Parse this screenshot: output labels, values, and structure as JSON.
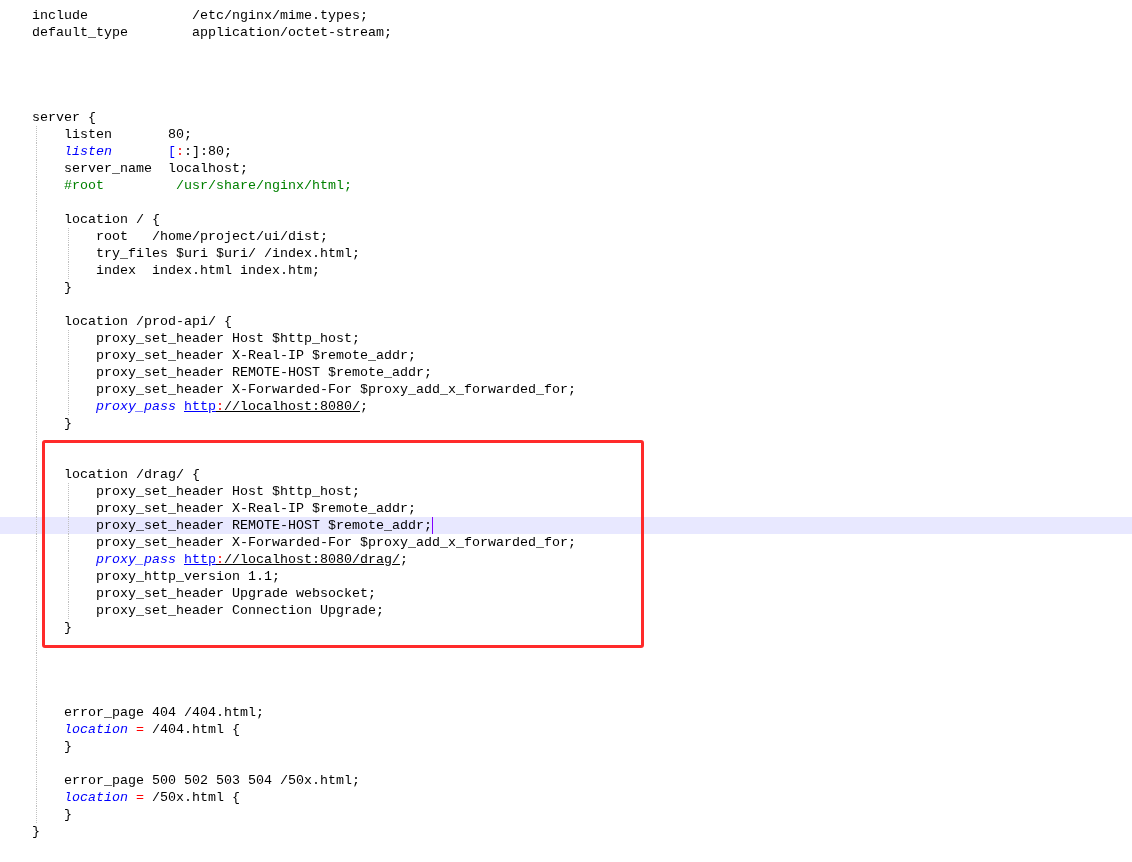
{
  "editor": {
    "lines": [
      {
        "kind": "code",
        "text": "include             /etc/nginx/mime.types;",
        "current": false
      },
      {
        "kind": "code",
        "text": "default_type        application/octet-stream;",
        "current": false
      },
      {
        "kind": "blank"
      },
      {
        "kind": "blank"
      },
      {
        "kind": "blank"
      },
      {
        "kind": "blank"
      },
      {
        "kind": "code",
        "text": "server {",
        "current": false
      },
      {
        "kind": "code",
        "text": "    listen       80;",
        "current": false
      },
      {
        "kind": "rich",
        "tokens": [
          {
            "kind": "kw",
            "text": "    listen       "
          },
          {
            "kind": "br",
            "text": "["
          },
          {
            "kind": "op",
            "text": ":"
          },
          {
            "kind": "plain",
            "text": ":]:80;"
          }
        ],
        "current": false
      },
      {
        "kind": "code",
        "text": "    server_name  localhost;",
        "current": false
      },
      {
        "kind": "rich",
        "tokens": [
          {
            "kind": "cm",
            "text": "    #root         /usr/share/nginx/html;"
          }
        ],
        "current": false
      },
      {
        "kind": "blank"
      },
      {
        "kind": "code",
        "text": "    location / {",
        "current": false
      },
      {
        "kind": "code",
        "text": "        root   /home/project/ui/dist;",
        "current": false
      },
      {
        "kind": "code",
        "text": "        try_files $uri $uri/ /index.html;",
        "current": false
      },
      {
        "kind": "code",
        "text": "        index  index.html index.htm;",
        "current": false
      },
      {
        "kind": "code",
        "text": "    }",
        "current": false
      },
      {
        "kind": "blank"
      },
      {
        "kind": "code",
        "text": "    location /prod-api/ {",
        "current": false
      },
      {
        "kind": "code",
        "text": "        proxy_set_header Host $http_host;",
        "current": false
      },
      {
        "kind": "code",
        "text": "        proxy_set_header X-Real-IP $remote_addr;",
        "current": false
      },
      {
        "kind": "code",
        "text": "        proxy_set_header REMOTE-HOST $remote_addr;",
        "current": false
      },
      {
        "kind": "code",
        "text": "        proxy_set_header X-Forwarded-For $proxy_add_x_forwarded_for;",
        "current": false
      },
      {
        "kind": "rich",
        "tokens": [
          {
            "kind": "kw",
            "text": "        proxy_pass "
          },
          {
            "kind": "scheme",
            "text": "http"
          },
          {
            "kind": "sep",
            "text": ":"
          },
          {
            "kind": "path",
            "text": "//localhost:8080/"
          },
          {
            "kind": "plain",
            "text": ";"
          }
        ],
        "current": false
      },
      {
        "kind": "code",
        "text": "    }",
        "current": false
      },
      {
        "kind": "blank"
      },
      {
        "kind": "annotation_box",
        "color": "#ff2a2a",
        "lines": [
          {
            "kind": "blank"
          },
          {
            "kind": "code",
            "text": "    location /drag/ {",
            "current": false
          },
          {
            "kind": "code",
            "text": "        proxy_set_header Host $http_host;",
            "current": false
          },
          {
            "kind": "code",
            "text": "        proxy_set_header X-Real-IP $remote_addr;",
            "current": false
          },
          {
            "kind": "code",
            "text": "        proxy_set_header REMOTE-HOST $remote_addr;",
            "current": true
          },
          {
            "kind": "code",
            "text": "        proxy_set_header X-Forwarded-For $proxy_add_x_forwarded_for;",
            "current": false
          },
          {
            "kind": "rich",
            "tokens": [
              {
                "kind": "kw",
                "text": "        proxy_pass "
              },
              {
                "kind": "scheme",
                "text": "http"
              },
              {
                "kind": "sep",
                "text": ":"
              },
              {
                "kind": "path",
                "text": "//localhost:8080/drag/"
              },
              {
                "kind": "plain",
                "text": ";"
              }
            ],
            "current": false
          },
          {
            "kind": "code",
            "text": "        proxy_http_version 1.1;",
            "current": false
          },
          {
            "kind": "code",
            "text": "        proxy_set_header Upgrade websocket;",
            "current": false
          },
          {
            "kind": "code",
            "text": "        proxy_set_header Connection Upgrade;",
            "current": false
          },
          {
            "kind": "code",
            "text": "    }",
            "current": false
          }
        ]
      },
      {
        "kind": "blank"
      },
      {
        "kind": "blank"
      },
      {
        "kind": "blank"
      },
      {
        "kind": "blank"
      },
      {
        "kind": "code",
        "text": "    error_page 404 /404.html;",
        "current": false
      },
      {
        "kind": "rich",
        "tokens": [
          {
            "kind": "kw",
            "text": "    location "
          },
          {
            "kind": "op",
            "text": "="
          },
          {
            "kind": "plain",
            "text": " /404.html {"
          }
        ],
        "current": false
      },
      {
        "kind": "code",
        "text": "    }",
        "current": false
      },
      {
        "kind": "blank"
      },
      {
        "kind": "code",
        "text": "    error_page 500 502 503 504 /50x.html;",
        "current": false
      },
      {
        "kind": "rich",
        "tokens": [
          {
            "kind": "kw",
            "text": "    location "
          },
          {
            "kind": "op",
            "text": "="
          },
          {
            "kind": "plain",
            "text": " /50x.html {"
          }
        ],
        "current": false
      },
      {
        "kind": "code",
        "text": "    }",
        "current": false
      },
      {
        "kind": "code",
        "text": "}",
        "current": false
      }
    ]
  }
}
